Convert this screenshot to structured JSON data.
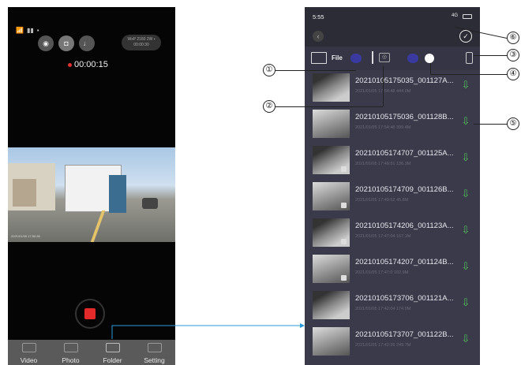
{
  "left_phone": {
    "rec_time": "00:00:15",
    "resolution_badge": "WxP 2160 2W ▪ 00:00:30",
    "video_timestamp": "2021/01/05 17:50:36",
    "nav": [
      {
        "label": "Video",
        "icon": "video-icon"
      },
      {
        "label": "Photo",
        "icon": "photo-icon"
      },
      {
        "label": "Folder",
        "icon": "folder-icon"
      },
      {
        "label": "Setting",
        "icon": "setting-icon"
      }
    ]
  },
  "right_phone": {
    "status_time": "5:55",
    "status_network": "4G",
    "toolbar": {
      "file_label": "File"
    },
    "files": [
      {
        "name": "20210105175035_001127A...",
        "meta": "2021/01/05 17:54:48    444.0M"
      },
      {
        "name": "20210105175036_001128B...",
        "meta": "2021/01/05 17:54:48    399.4M"
      },
      {
        "name": "20210105174707_001125A...",
        "meta": "2021/01/05 17:49:51    136.3M"
      },
      {
        "name": "20210105174709_001126B...",
        "meta": "2021/01/05 17:49:52    45.8M"
      },
      {
        "name": "20210105174206_001123A...",
        "meta": "2021/01/05 17:47:04    167.1M"
      },
      {
        "name": "20210105174207_001124B...",
        "meta": "2021/01/05 17:47:0    102.9M"
      },
      {
        "name": "20210105173706_001121A...",
        "meta": "2021/01/05 17:42:04    174.0M"
      },
      {
        "name": "20210105173707_001122B...",
        "meta": "2021/01/05 17:42:26    249.7M"
      }
    ]
  },
  "callouts": [
    "①",
    "②",
    "③",
    "④",
    "⑤",
    "⑥"
  ]
}
